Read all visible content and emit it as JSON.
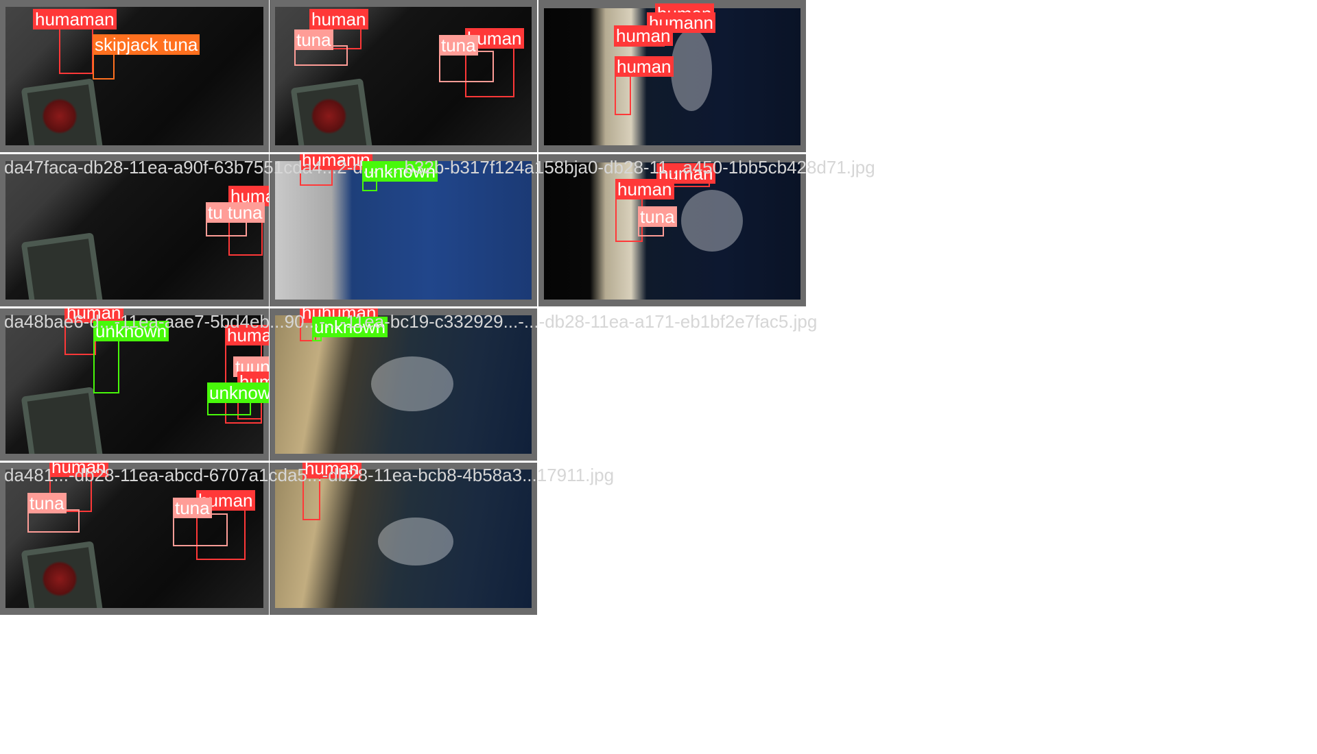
{
  "filenames": {
    "row2": "da47faca-db28-11ea-a90f-63b7551cda4...2-d...-...-b32b-b317f124a158bja0-db28-11...a450-1bb5cb428d71.jpg",
    "row3": "da48bae6-d...-11ea-aae7-5bd4eb...90...-...-11ea-bc19-c332929...-...-db28-11ea-a171-eb1bf2e7fac5.jpg",
    "row4": "da481...-db28-11ea-abcd-6707a1cda5...-db28-11ea-bcb8-4b58a3...17911.jpg"
  },
  "labels": {
    "human": "human",
    "tuna": "tuna",
    "skipjack": "skipjack tuna",
    "unknown": "unknown",
    "humanan": "humaman",
    "huhuman": "huhuman",
    "humann": "humann",
    "humanin": "humanin",
    "tuuna": "tu tuna",
    "tuunknown": "tuunknown",
    "unkhown": "unknown",
    "tunc": "tuna",
    "huinan": "human"
  },
  "colors": {
    "human": "#ff3838",
    "tuna": "#ff9d97",
    "skipjack": "#ff701f",
    "unknown": "#48f90a"
  }
}
